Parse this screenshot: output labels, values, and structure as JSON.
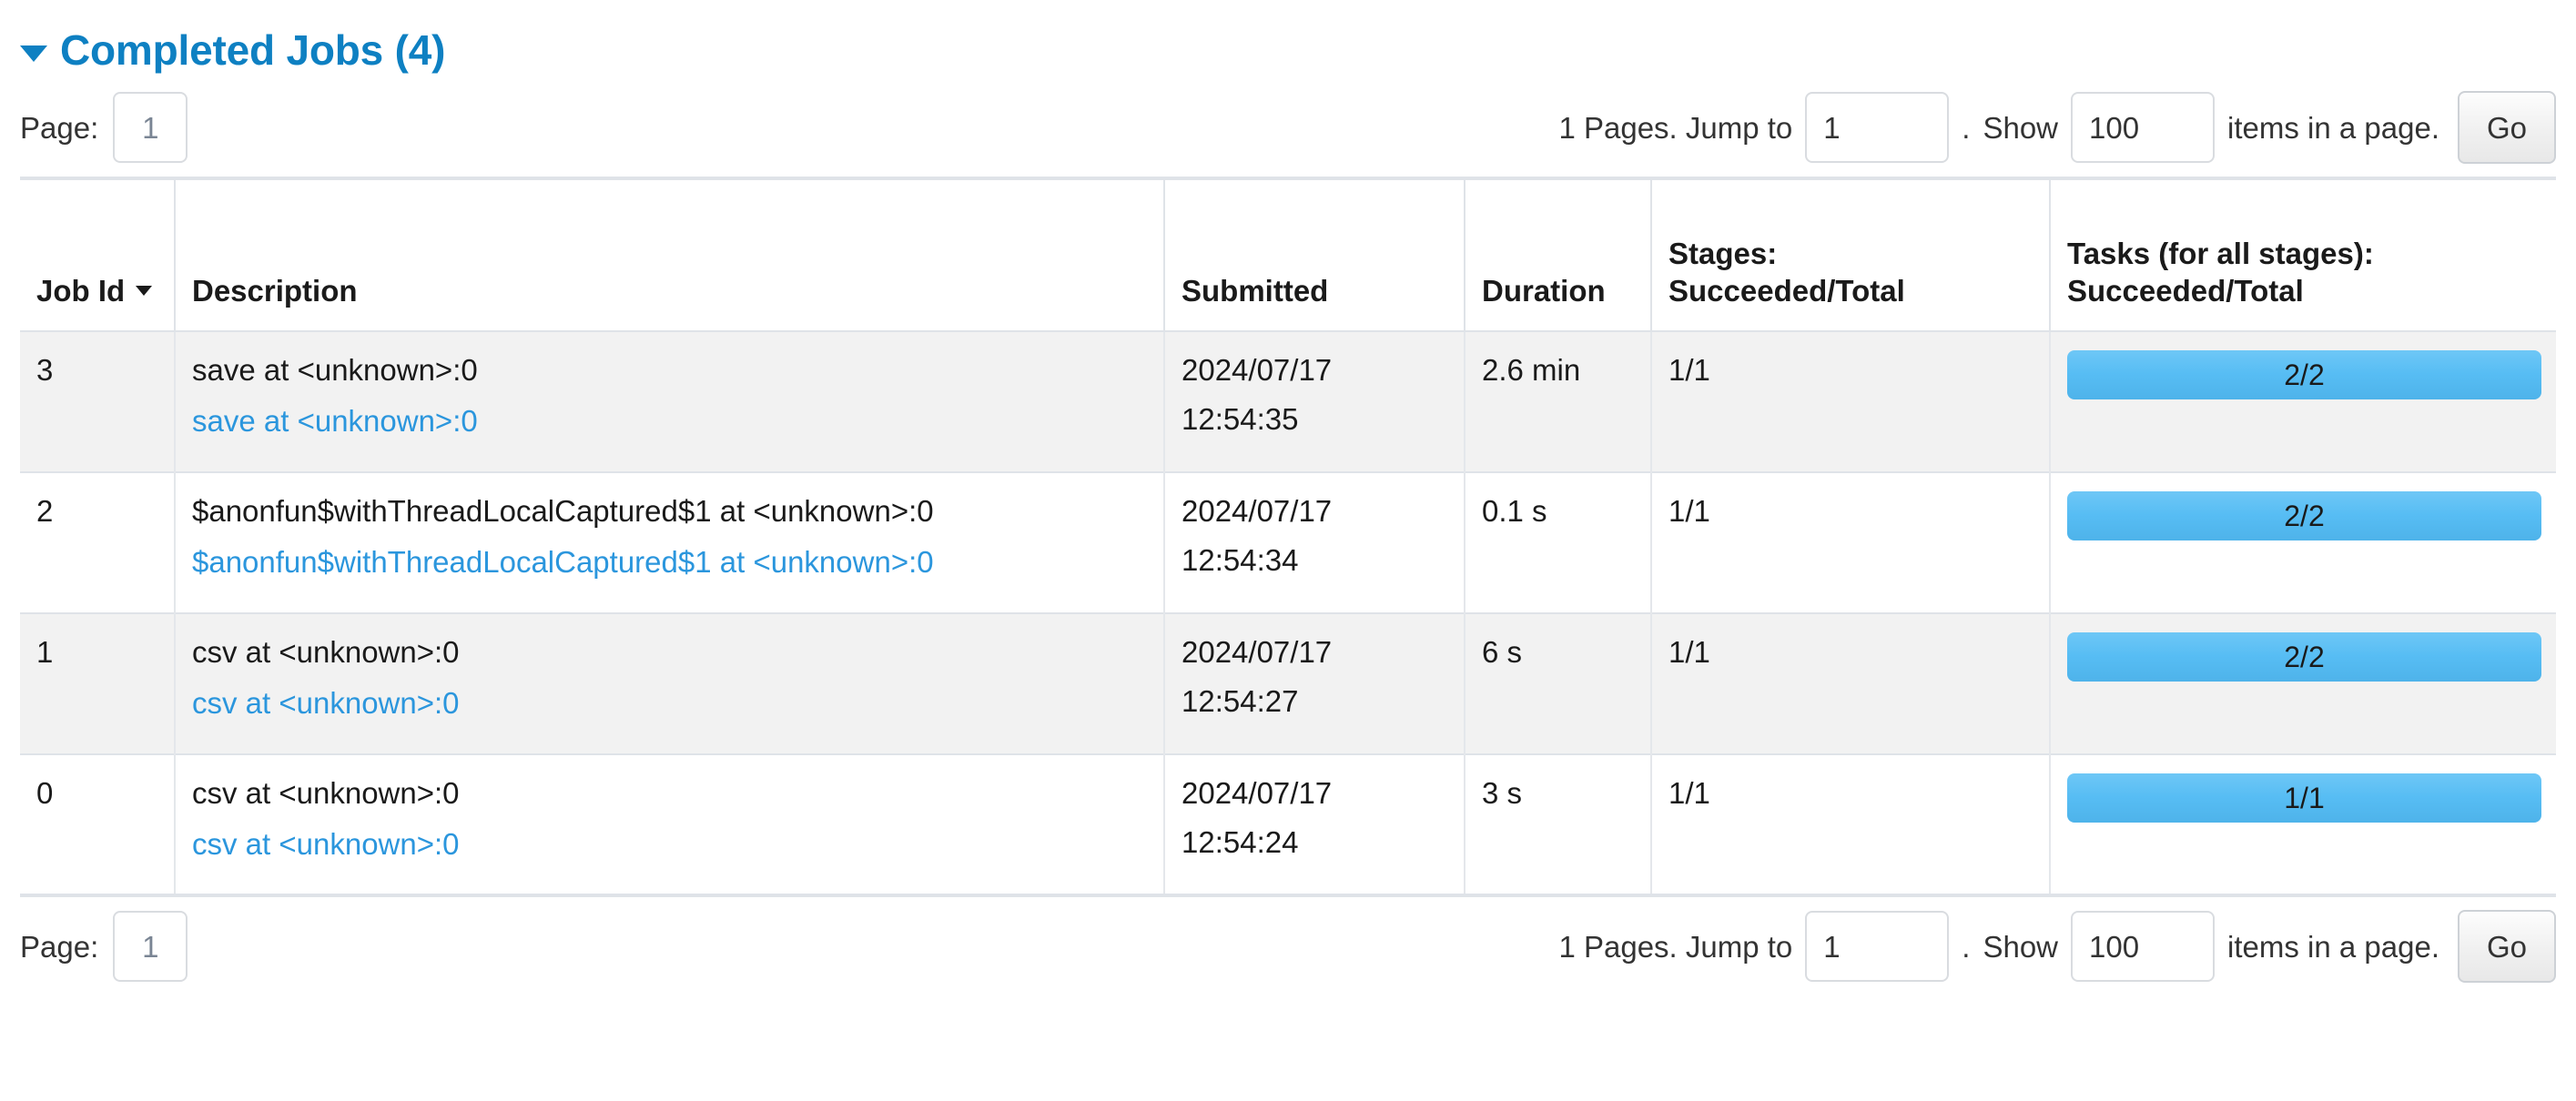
{
  "section": {
    "title": "Completed Jobs (4)",
    "caret_icon": "caret-down-icon"
  },
  "pagination": {
    "page_label": "Page:",
    "current_page": "1",
    "pages_prefix": "1 Pages. Jump to",
    "jump_value": "1",
    "separator": ".",
    "show_label": "Show",
    "show_value": "100",
    "items_suffix": "items in a page.",
    "go_label": "Go"
  },
  "table": {
    "columns": {
      "job_id": "Job Id",
      "description": "Description",
      "submitted": "Submitted",
      "duration": "Duration",
      "stages_line1": "Stages:",
      "stages_line2": "Succeeded/Total",
      "tasks_line1": "Tasks (for all stages):",
      "tasks_line2": "Succeeded/Total"
    },
    "sort_column": "job_id",
    "sort_direction": "desc",
    "rows": [
      {
        "job_id": "3",
        "description": "save at <unknown>:0",
        "description_link": "save at <unknown>:0",
        "submitted_date": "2024/07/17",
        "submitted_time": "12:54:35",
        "duration": "2.6 min",
        "stages": "1/1",
        "tasks": "2/2",
        "tasks_percent": 100
      },
      {
        "job_id": "2",
        "description": "$anonfun$withThreadLocalCaptured$1 at <unknown>:0",
        "description_link": "$anonfun$withThreadLocalCaptured$1 at <unknown>:0",
        "submitted_date": "2024/07/17",
        "submitted_time": "12:54:34",
        "duration": "0.1 s",
        "stages": "1/1",
        "tasks": "2/2",
        "tasks_percent": 100
      },
      {
        "job_id": "1",
        "description": "csv at <unknown>:0",
        "description_link": "csv at <unknown>:0",
        "submitted_date": "2024/07/17",
        "submitted_time": "12:54:27",
        "duration": "6 s",
        "stages": "1/1",
        "tasks": "2/2",
        "tasks_percent": 100
      },
      {
        "job_id": "0",
        "description": "csv at <unknown>:0",
        "description_link": "csv at <unknown>:0",
        "submitted_date": "2024/07/17",
        "submitted_time": "12:54:24",
        "duration": "3 s",
        "stages": "1/1",
        "tasks": "1/1",
        "tasks_percent": 100
      }
    ]
  },
  "colors": {
    "heading_blue": "#0e80c2",
    "link_blue": "#2b96dd",
    "progress_blue": "#57bdf4",
    "row_stripe": "#f2f2f2",
    "border_gray": "#dfe3e8"
  }
}
